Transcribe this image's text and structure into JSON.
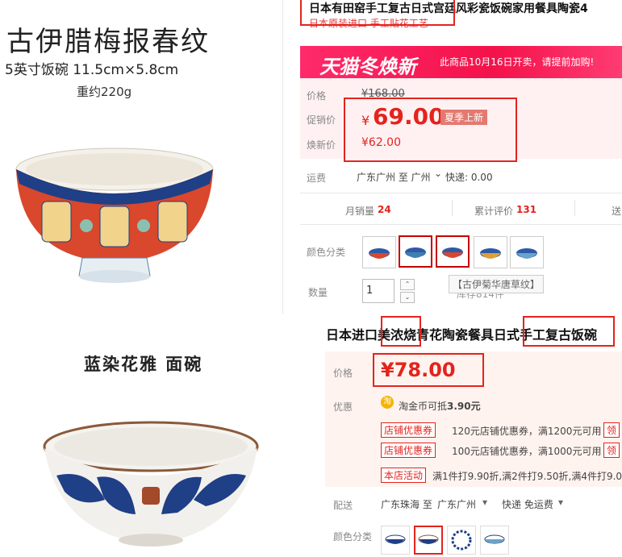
{
  "left_top": {
    "title": "古伊腊梅报春纹",
    "size": "5英寸饭碗 11.5cm×5.8cm",
    "weight": "重约220g"
  },
  "right_top": {
    "title": "日本有田窑手工复古日式宫廷风彩瓷饭碗家用餐具陶瓷4",
    "subtitle": "日本原装进口 手工贴花工艺",
    "banner_logo": "天猫冬焕新",
    "banner_text": "此商品10月16日开卖，请提前加购!",
    "price_label": "价格",
    "price_original": "¥168.00",
    "promo_label": "促销价",
    "promo_yen": "¥",
    "promo_price": "69.00",
    "promo_tag": "夏季上新",
    "new_label": "焕新价",
    "new_price": "¥62.00",
    "shipping_label": "运费",
    "shipping_value": "广东广州 至 广州",
    "shipping_arrow": "⌄",
    "shipping_fee": "快递: 0.00",
    "monthly_sales_label": "月销量",
    "monthly_sales_value": "24",
    "reviews_label": "累计评价",
    "reviews_value": "131",
    "gift_label": "送",
    "color_label": "颜色分类",
    "quantity_label": "数量",
    "quantity_value": "1",
    "stock_text": "库存814件",
    "tooltip_text": "【古伊菊华唐草纹】",
    "stepper_up": "⌃",
    "stepper_down": "⌄"
  },
  "left_bottom": {
    "title": "蓝染花雅 面碗"
  },
  "right_bottom": {
    "title": "日本进口美浓烧青花陶瓷餐具日式手工复古饭碗",
    "price_label": "价格",
    "price_value": "¥78.00",
    "discount_label": "优惠",
    "coin_icon_text": "淘",
    "coin_text": "淘金币可抵",
    "coin_amount": "3.90元",
    "coupon_tag": "店铺优惠券",
    "coupon1": "120元店铺优惠券，满1200元可用",
    "coupon2": "100元店铺优惠券，满1000元可用",
    "claim": "领",
    "activity_tag": "本店活动",
    "activity_text": "满1件打9.90折,满2件打9.50折,满4件打9.0",
    "delivery_label": "配送",
    "delivery_from": "广东珠海 至",
    "delivery_to": "广东广州",
    "delivery_method": "快递 免运费",
    "dropdown_arrow": "▾",
    "color_label": "颜色分类"
  },
  "colors": {
    "red": "#e4231d",
    "banner_pink": "#f4124a",
    "price_bg": "#fff1f2",
    "blue_glaze": "#1f3f86"
  }
}
